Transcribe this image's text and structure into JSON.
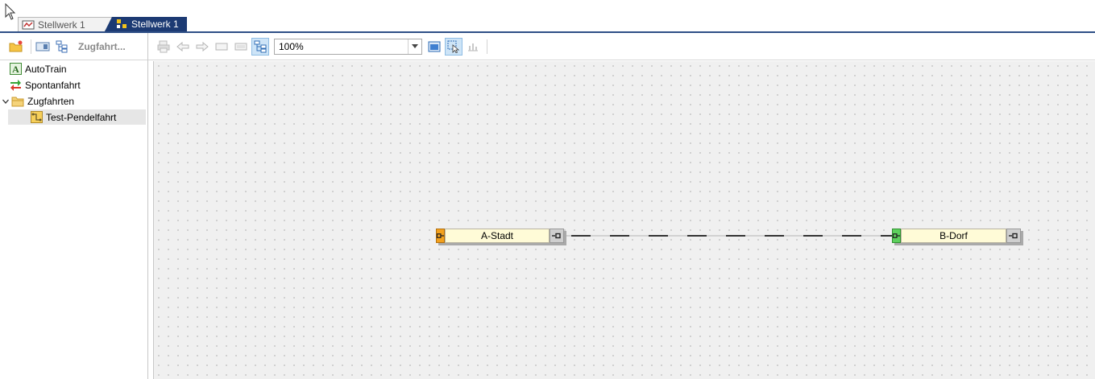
{
  "tabs": [
    {
      "label": "Stellwerk 1",
      "active": false
    },
    {
      "label": "Stellwerk 1",
      "active": true
    }
  ],
  "left_toolbar": {
    "label": "Zugfahrt..."
  },
  "tree": {
    "items": [
      {
        "label": "AutoTrain",
        "icon": "autotrain-icon"
      },
      {
        "label": "Spontanfahrt",
        "icon": "spontanfahrt-icon"
      },
      {
        "label": "Zugfahrten",
        "icon": "folder-icon",
        "expanded": true
      },
      {
        "label": "Test-Pendelfahrt",
        "icon": "route-icon",
        "selected": true
      }
    ]
  },
  "toolbar": {
    "zoom_value": "100%"
  },
  "diagram": {
    "stations": [
      {
        "name": "A-Stadt",
        "state": "start"
      },
      {
        "name": "B-Dorf",
        "state": "end"
      }
    ]
  },
  "colors": {
    "tab_active": "#1c3a73",
    "station_fill": "#fffbd7",
    "start_cap": "#f3a11d",
    "end_cap": "#5dd05d"
  }
}
